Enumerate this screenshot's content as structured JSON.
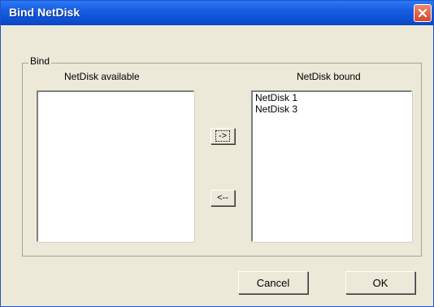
{
  "window": {
    "title": "Bind NetDisk"
  },
  "group": {
    "label": "Bind"
  },
  "available": {
    "header": "NetDisk available",
    "items": []
  },
  "bound": {
    "header": "NetDisk bound",
    "items": [
      "NetDisk 1",
      "NetDisk 3"
    ]
  },
  "buttons": {
    "add": "->",
    "remove": "<--",
    "cancel": "Cancel",
    "ok": "OK"
  },
  "icons": {
    "close": "close-icon"
  }
}
